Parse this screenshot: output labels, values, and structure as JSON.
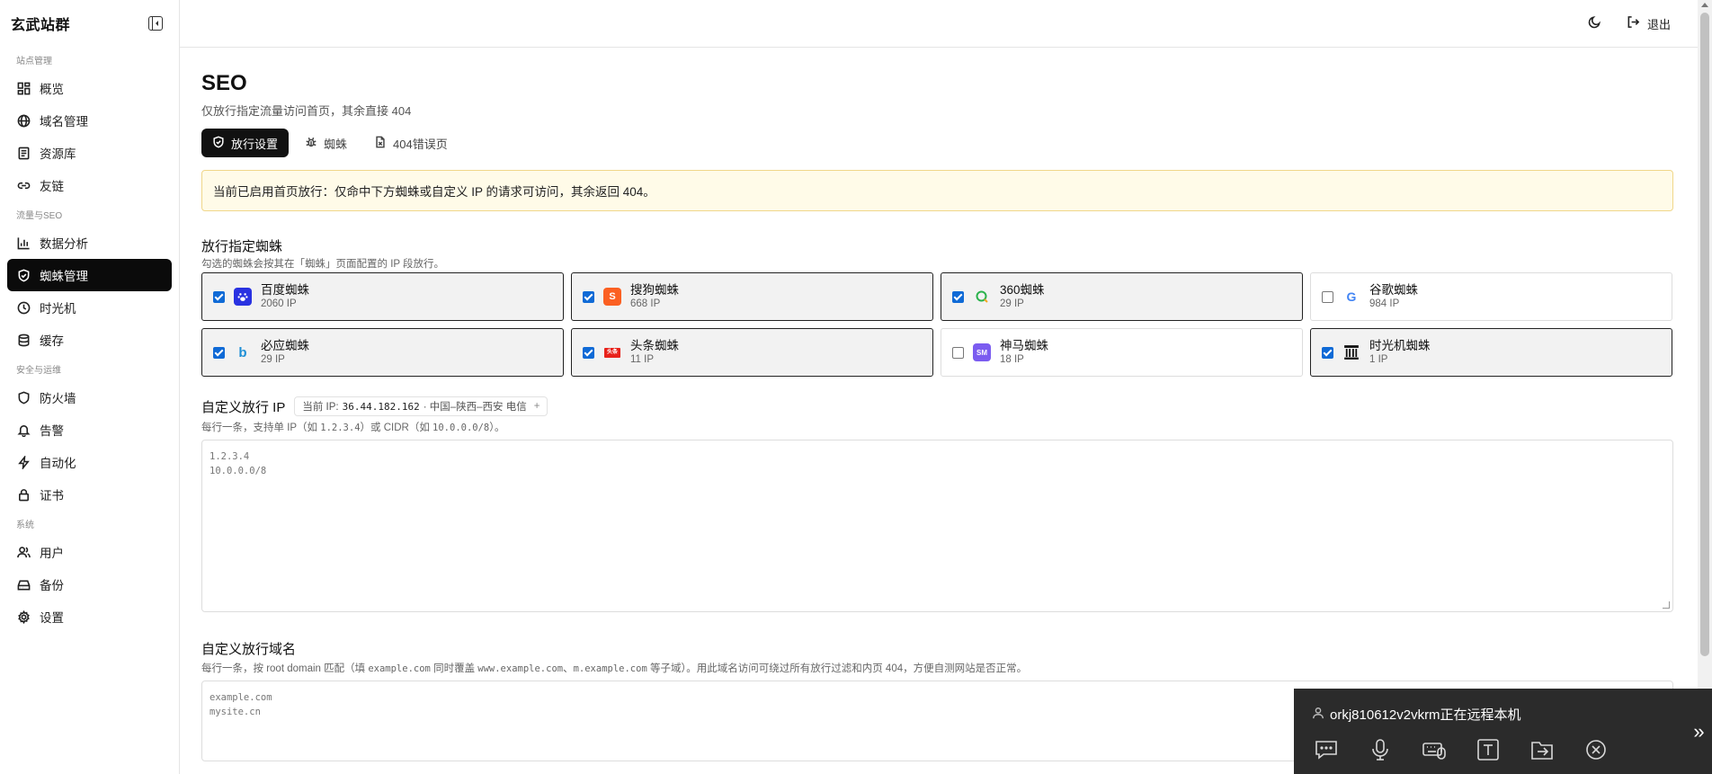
{
  "brand": {
    "title": "玄武站群"
  },
  "sidebar": {
    "groups": [
      {
        "title": "站点管理",
        "items": [
          {
            "label": "概览",
            "icon": "dashboard-icon"
          },
          {
            "label": "域名管理",
            "icon": "globe-icon"
          },
          {
            "label": "资源库",
            "icon": "book-icon"
          },
          {
            "label": "友链",
            "icon": "link-icon"
          }
        ]
      },
      {
        "title": "流量与SEO",
        "items": [
          {
            "label": "数据分析",
            "icon": "bar-chart-icon"
          },
          {
            "label": "蜘蛛管理",
            "icon": "shield-icon",
            "active": true
          },
          {
            "label": "时光机",
            "icon": "clock-icon"
          },
          {
            "label": "缓存",
            "icon": "database-icon"
          }
        ]
      },
      {
        "title": "安全与运维",
        "items": [
          {
            "label": "防火墙",
            "icon": "shield-outline-icon"
          },
          {
            "label": "告警",
            "icon": "bell-icon"
          },
          {
            "label": "自动化",
            "icon": "lightning-icon"
          },
          {
            "label": "证书",
            "icon": "lock-icon"
          }
        ]
      },
      {
        "title": "系统",
        "items": [
          {
            "label": "用户",
            "icon": "users-icon"
          },
          {
            "label": "备份",
            "icon": "hard-drive-icon"
          },
          {
            "label": "设置",
            "icon": "gear-icon"
          }
        ]
      }
    ]
  },
  "topbar": {
    "logout_label": "退出"
  },
  "page": {
    "title": "SEO",
    "subtitle": "仅放行指定流量访问首页，其余直接 404",
    "tabs": [
      {
        "label": "放行设置",
        "icon": "shield-check-icon",
        "active": true
      },
      {
        "label": "蜘蛛",
        "icon": "bug-icon"
      },
      {
        "label": "404错误页",
        "icon": "file-x-icon"
      }
    ],
    "notice": "当前已启用首页放行：仅命中下方蜘蛛或自定义 IP 的请求可访问，其余返回 404。"
  },
  "spiders": {
    "title": "放行指定蜘蛛",
    "subtitle": "勾选的蜘蛛会按其在「蜘蛛」页面配置的 IP 段放行。",
    "items": [
      {
        "name": "百度蜘蛛",
        "count": "2060 IP",
        "checked": true,
        "logo_color": "#2932e1",
        "logo_text": "du"
      },
      {
        "name": "搜狗蜘蛛",
        "count": "668 IP",
        "checked": true,
        "logo_color": "#fb6022",
        "logo_text": "S"
      },
      {
        "name": "360蜘蛛",
        "count": "29 IP",
        "checked": true,
        "logo_color": "#ffffff",
        "logo_text": "Q"
      },
      {
        "name": "谷歌蜘蛛",
        "count": "984 IP",
        "checked": false,
        "logo_color": "#ffffff",
        "logo_text": "G"
      },
      {
        "name": "必应蜘蛛",
        "count": "29 IP",
        "checked": true,
        "logo_color": "#ffffff",
        "logo_text": "b"
      },
      {
        "name": "头条蜘蛛",
        "count": "11 IP",
        "checked": true,
        "logo_color": "#ffffff",
        "logo_text": "头条"
      },
      {
        "name": "神马蜘蛛",
        "count": "18 IP",
        "checked": false,
        "logo_color": "#7b5cf0",
        "logo_text": "SM"
      },
      {
        "name": "时光机蜘蛛",
        "count": "1 IP",
        "checked": true,
        "logo_color": "#ffffff",
        "logo_text": "IA"
      }
    ]
  },
  "custom_ip": {
    "title": "自定义放行 IP",
    "chip_prefix": "当前 IP:",
    "chip_ip": "36.44.182.162",
    "chip_location": "· 中国–陕西–西安 电信",
    "chip_plus": "+",
    "help_a": "每行一条，支持单 IP（如 ",
    "help_ex1": "1.2.3.4",
    "help_b": "）或 CIDR（如 ",
    "help_ex2": "10.0.0.0/8",
    "help_c": "）。",
    "placeholder_line1": "1.2.3.4",
    "placeholder_line2": "10.0.0.0/8"
  },
  "custom_domain": {
    "title": "自定义放行域名",
    "help_a": "每行一条，按 root domain 匹配（填 ",
    "help_ex1": "example.com",
    "help_b": " 同时覆盖 ",
    "help_ex2": "www.example.com",
    "help_c": "、",
    "help_ex3": "m.example.com",
    "help_d": " 等子域）。用此域名访问可绕过所有放行过滤和内页 404，方便自测网站是否正常。",
    "placeholder_line1": "example.com",
    "placeholder_line2": "mysite.cn"
  },
  "remote": {
    "text": "orkj810612v2vkrm正在远程本机",
    "tools": [
      "chat-icon",
      "microphone-icon",
      "keyboard-mouse-icon",
      "text-icon",
      "file-transfer-icon",
      "close-circle-icon"
    ],
    "expand": "»"
  }
}
